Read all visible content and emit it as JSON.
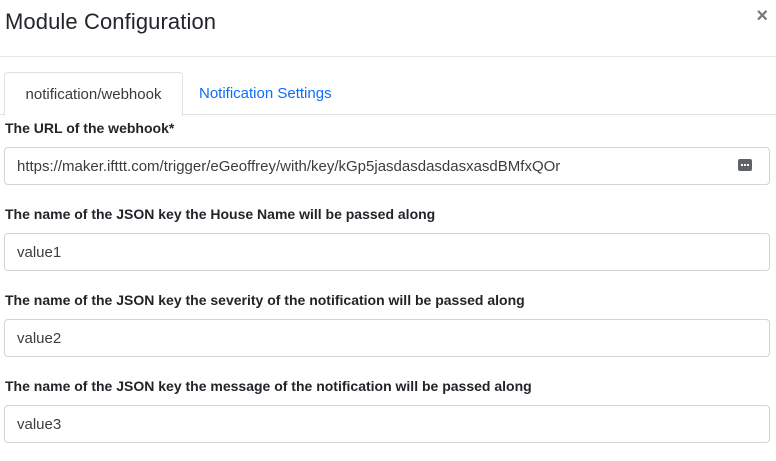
{
  "modal": {
    "title": "Module Configuration",
    "close_glyph": "×"
  },
  "tabs": [
    {
      "label": "notification/webhook",
      "active": true
    },
    {
      "label": "Notification Settings",
      "active": false
    }
  ],
  "fields": {
    "url": {
      "label": "The URL of the webhook*",
      "value": "https://maker.ifttt.com/trigger/eGeoffrey/with/key/kGp5jasdasdasdasxasdBMfxQOr",
      "icon": "keyboard-icon"
    },
    "house_key": {
      "label": "The name of the JSON key the House Name will be passed along",
      "value": "value1"
    },
    "severity_key": {
      "label": "The name of the JSON key the severity of the notification will be passed along",
      "value": "value2"
    },
    "message_key": {
      "label": "The name of the JSON key the message of the notification will be passed along",
      "value": "value3"
    }
  },
  "colors": {
    "link": "#0d6efd",
    "border": "#ced4da",
    "text": "#212529"
  }
}
